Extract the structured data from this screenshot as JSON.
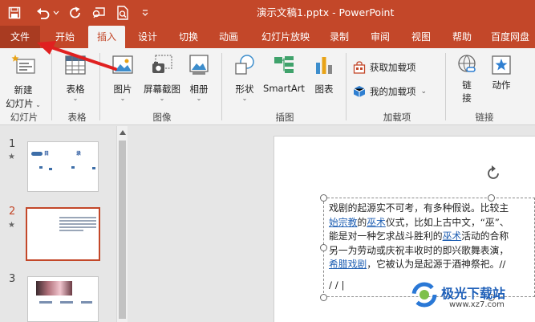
{
  "window": {
    "title": "演示文稿1.pptx  -  PowerPoint"
  },
  "qat": [
    {
      "name": "save",
      "icon": "save-icon"
    },
    {
      "name": "undo",
      "icon": "undo-icon"
    },
    {
      "name": "redo",
      "icon": "redo-icon"
    },
    {
      "name": "present",
      "icon": "present-from-start-icon"
    },
    {
      "name": "preview",
      "icon": "print-preview-icon"
    },
    {
      "name": "customize",
      "icon": "customize-qat-icon"
    }
  ],
  "tabs": [
    "文件",
    "开始",
    "插入",
    "设计",
    "切换",
    "动画",
    "幻灯片放映",
    "录制",
    "审阅",
    "视图",
    "帮助",
    "百度网盘"
  ],
  "active_tab": "插入",
  "ribbon": {
    "slides": {
      "new_slide_line1": "新建",
      "new_slide_line2": "幻灯片",
      "group": "幻灯片"
    },
    "tables": {
      "table": "表格",
      "group": "表格"
    },
    "images": {
      "picture": "图片",
      "screenshot": "屏幕截图",
      "album": "相册",
      "group": "图像"
    },
    "illustrations": {
      "shapes": "形状",
      "smartart": "SmartArt",
      "chart": "图表",
      "group": "插图"
    },
    "addins": {
      "get": "获取加载项",
      "mine": "我的加载项",
      "group": "加载项"
    },
    "links": {
      "link_line1": "链",
      "link_line2": "接",
      "action": "动作",
      "group": "链接"
    }
  },
  "thumbnails": [
    {
      "number": "1",
      "star": "★",
      "title_left": "目",
      "title_right": "录"
    },
    {
      "number": "2",
      "star": "★"
    },
    {
      "number": "3"
    }
  ],
  "slide_text": {
    "line1": "戏剧的起源实不可考，有多种假说。比较主",
    "line2_link1": "始宗教",
    "line2_a": "的",
    "line2_link2": "巫术",
    "line2_b": "仪式，比如上古中文，“巫”、",
    "line3_a": "能是对一种乞求战斗胜利的",
    "line3_link": "巫术",
    "line3_b": "活动的合称",
    "line4": "另一为劳动或庆祝丰收时的即兴歌舞表演，",
    "line5_link": "希腊戏剧",
    "line5_b": "，它被认为是起源于酒神祭祀。//",
    "line6": "/ / |"
  },
  "watermark": {
    "brand": "极光下载站",
    "url": "www.xz7.com"
  },
  "colors": {
    "accent": "#c34729",
    "file_tab": "#a93b21",
    "ribbon_bg": "#f3f3f3",
    "pane_bg": "#e6e6e6",
    "link": "#1f5fb3",
    "arrow": "#e02020"
  }
}
